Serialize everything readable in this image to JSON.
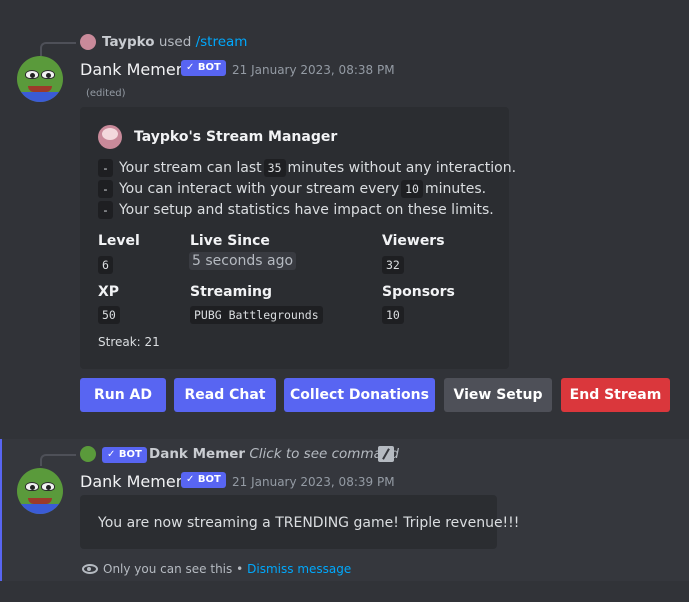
{
  "message1": {
    "reply": {
      "user": "Taypko",
      "used": "used",
      "command": "/stream"
    },
    "author": "Dank Memer",
    "bot_badge": "✓ BOT",
    "timestamp": "21 January 2023, 08:38 PM",
    "edited": "(edited)",
    "embed": {
      "author": "Taypko's Stream Manager",
      "lines": [
        {
          "bullet": "-",
          "before": "Your stream can last",
          "code": "35",
          "after": "minutes without any interaction."
        },
        {
          "bullet": "-",
          "before": "You can interact with your stream every",
          "code": "10",
          "after": "minutes."
        },
        {
          "bullet": "-",
          "text": "Your setup and statistics have impact on these limits."
        }
      ],
      "fields": {
        "level": {
          "name": "Level",
          "value": "6"
        },
        "live_since": {
          "name": "Live Since",
          "value": "5 seconds ago"
        },
        "viewers": {
          "name": "Viewers",
          "value": "32"
        },
        "xp": {
          "name": "XP",
          "value": "50"
        },
        "streaming": {
          "name": "Streaming",
          "value": "PUBG Battlegrounds"
        },
        "sponsors": {
          "name": "Sponsors",
          "value": "10"
        }
      },
      "footer": "Streak: 21"
    },
    "buttons": {
      "run_ad": "Run AD",
      "read_chat": "Read Chat",
      "collect_donations": "Collect Donations",
      "view_setup": "View Setup",
      "end_stream": "End Stream"
    }
  },
  "message2": {
    "reply": {
      "bot_badge": "✓ BOT",
      "user": "Dank Memer",
      "hint": "Click to see command"
    },
    "author": "Dank Memer",
    "bot_badge": "✓ BOT",
    "timestamp": "21 January 2023, 08:39 PM",
    "content": "You are now streaming a TRENDING game! Triple revenue!!!",
    "footer": {
      "text": "Only you can see this •",
      "dismiss": "Dismiss message"
    }
  },
  "colors": {
    "blurple": "#5865f2",
    "secondary": "#4e5058",
    "danger": "#da373c",
    "link": "#00a8fc",
    "background": "#313338",
    "embed": "#2b2d31"
  },
  "icons": [
    "eye-icon",
    "slash-command-icon",
    "pepe-avatar"
  ]
}
